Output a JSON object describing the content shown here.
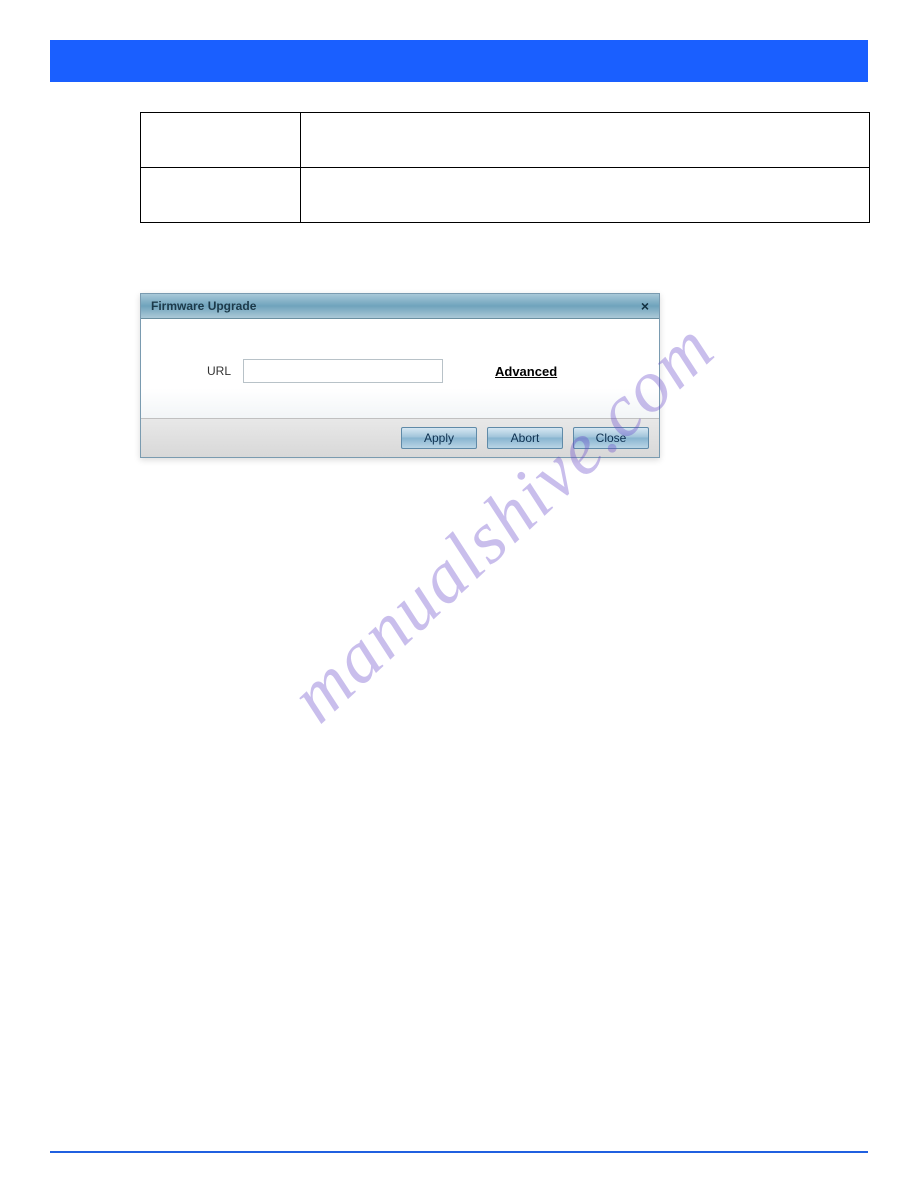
{
  "table": {
    "rows": [
      {
        "col1": "",
        "col2": ""
      },
      {
        "col1": "",
        "col2": ""
      }
    ]
  },
  "dialog": {
    "title": "Firmware Upgrade",
    "close_glyph": "×",
    "url_label": "URL",
    "url_value": "",
    "advanced_label": "Advanced",
    "buttons": {
      "apply": "Apply",
      "abort": "Abort",
      "close": "Close"
    }
  },
  "watermark": "manualshive.com"
}
